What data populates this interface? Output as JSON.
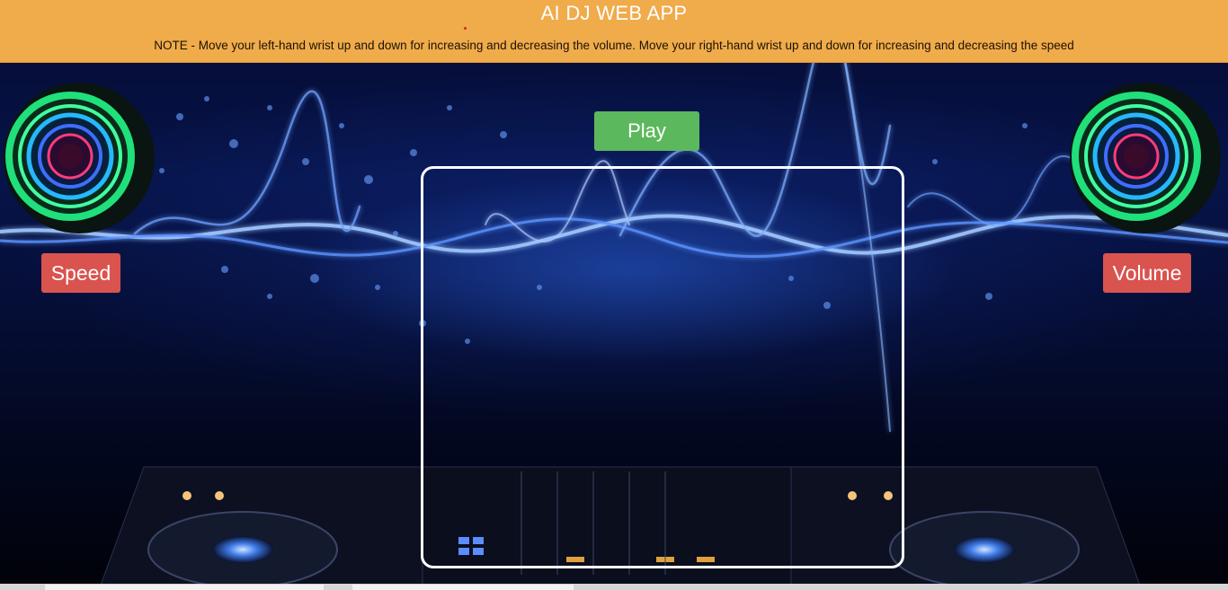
{
  "header": {
    "title": "AI DJ WEB APP",
    "note": "NOTE - Move your left-hand wrist up and down for increasing and decreasing the volume. Move your right-hand wrist up and down for increasing and decreasing the speed"
  },
  "controls": {
    "play_label": "Play",
    "speed_label": "Speed",
    "volume_label": "Volume"
  },
  "colors": {
    "header_bg": "#f0ab4b",
    "play_button": "#5cb85c",
    "speed_volume_button": "#d9534f",
    "frame_border": "#ffffff"
  },
  "icons": {
    "left_speaker": "neon-speaker-icon",
    "right_speaker": "neon-speaker-icon"
  }
}
